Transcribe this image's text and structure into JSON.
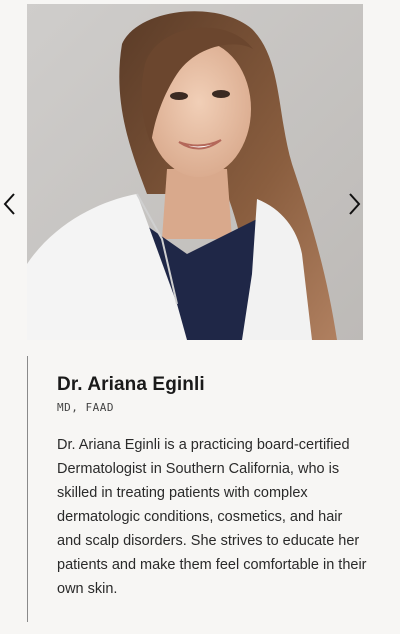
{
  "carousel": {
    "prev_icon": "chevron-left-icon",
    "next_icon": "chevron-right-icon",
    "photo_alt": "Dr. Ariana Eginli"
  },
  "doctor": {
    "name": "Dr. Ariana Eginli",
    "credentials": "MD, FAAD",
    "bio": "Dr. Ariana Eginli is a practicing board-certified Dermatologist in Southern California, who is skilled in treating patients with complex dermatologic conditions, cosmetics, and hair and scalp disorders. She strives to educate her patients and make them feel comfortable in their own skin."
  },
  "colors": {
    "background": "#f7f6f4",
    "divider": "#8a8a8a",
    "text": "#1a1a1a"
  }
}
